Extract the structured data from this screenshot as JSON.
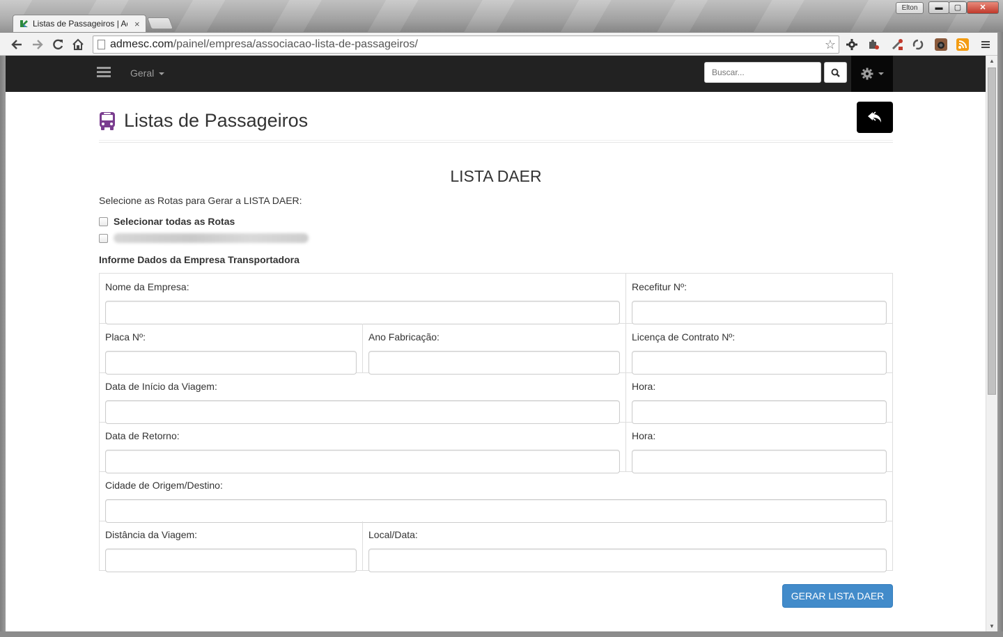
{
  "browser": {
    "tab_title": "Listas de Passageiros | Adm",
    "tab_close": "×",
    "user_badge": "Elton",
    "window_buttons": {
      "minimize": "▬",
      "maximize": "▢",
      "close": "✕"
    },
    "url_host": "admesc.com",
    "url_path": "/painel/empresa/associacao-lista-de-passageiros/",
    "icons": [
      "back-arrow-icon",
      "forward-arrow-icon",
      "reload-icon",
      "home-icon",
      "bookmark-star-icon",
      "gear-extension-icon",
      "puzzle-extension-icon",
      "eyedropper-extension-icon",
      "sync-extension-icon",
      "camera-extension-icon",
      "rss-extension-icon",
      "chrome-menu-icon"
    ]
  },
  "navbar": {
    "menu_label": "Geral",
    "search_placeholder": "Buscar...",
    "search_icon": "search-icon",
    "settings_icon": "gear-icon",
    "background": "#222222"
  },
  "page": {
    "title": "Listas de Passageiros",
    "title_icon": "bus-icon",
    "title_icon_color": "#7a3d8f",
    "back_icon": "reply-icon",
    "section_title": "LISTA DAER",
    "select_routes_label": "Selecione as Rotas para Gerar a LISTA DAER:",
    "select_all_label": "Selecionar todas as Rotas",
    "company_section_label": "Informe Dados da Empresa Transportadora"
  },
  "form": {
    "rows": [
      [
        {
          "label": "Nome da Empresa:"
        },
        {
          "label": "Recefitur Nº:"
        }
      ],
      [
        {
          "label": "Placa Nº:"
        },
        {
          "label": "Ano Fabricação:"
        },
        {
          "label": "Licença de Contrato Nº:"
        }
      ],
      [
        {
          "label": "Data de Início da Viagem:"
        },
        {
          "label": "Hora:"
        }
      ],
      [
        {
          "label": "Data de Retorno:"
        },
        {
          "label": "Hora:"
        }
      ],
      [
        {
          "label": "Cidade de Origem/Destino:"
        }
      ],
      [
        {
          "label": "Distância da Viagem:"
        },
        {
          "label": "Local/Data:"
        }
      ]
    ],
    "submit_label": "GERAR LISTA DAER",
    "submit_color": "#428bca"
  }
}
